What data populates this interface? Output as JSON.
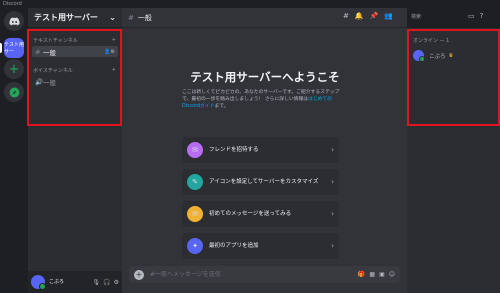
{
  "app": {
    "title": "Discord"
  },
  "servers": {
    "active_label": "テスト用サー",
    "add_label": "+"
  },
  "channels": {
    "server_name": "テスト用サーバー",
    "text_category": "テキストチャンネル",
    "voice_category": "ボイスチャンネル",
    "text_channels": [
      {
        "name": "一般"
      }
    ],
    "voice_channels": [
      {
        "name": "一般"
      }
    ]
  },
  "user": {
    "name": "こぶろ"
  },
  "topbar": {
    "channel_name": "一般",
    "search_placeholder": "検索"
  },
  "welcome": {
    "title": "テスト用サーバーへようこそ",
    "desc_part1": "ここは新しくてピカピカの、あなたのサーバーです。ご紹介するステップで、最初の一歩を踏み出しましょう！ さらに詳しい情報は",
    "desc_link": "はじめてのDiscordガイド",
    "desc_part2": "まで。"
  },
  "cards": [
    {
      "label": "フレンドを招待する",
      "icon": "invite-icon",
      "color": "#b86cf2"
    },
    {
      "label": "アイコンを設定してサーバーをカスタマイズ",
      "icon": "customize-icon",
      "color": "#23a5a0"
    },
    {
      "label": "初めてのメッセージを送ってみる",
      "icon": "message-icon",
      "color": "#f0b232"
    },
    {
      "label": "最初のアプリを追加",
      "icon": "app-icon",
      "color": "#5865f2"
    }
  ],
  "composer": {
    "placeholder": "#一般へメッセージを送信"
  },
  "members": {
    "online_header": "オンライン — 1",
    "list": [
      {
        "name": "こぶろ"
      }
    ]
  },
  "colors": {
    "accent": "#5865f2",
    "online": "#23a559",
    "highlight": "#e0141e"
  }
}
